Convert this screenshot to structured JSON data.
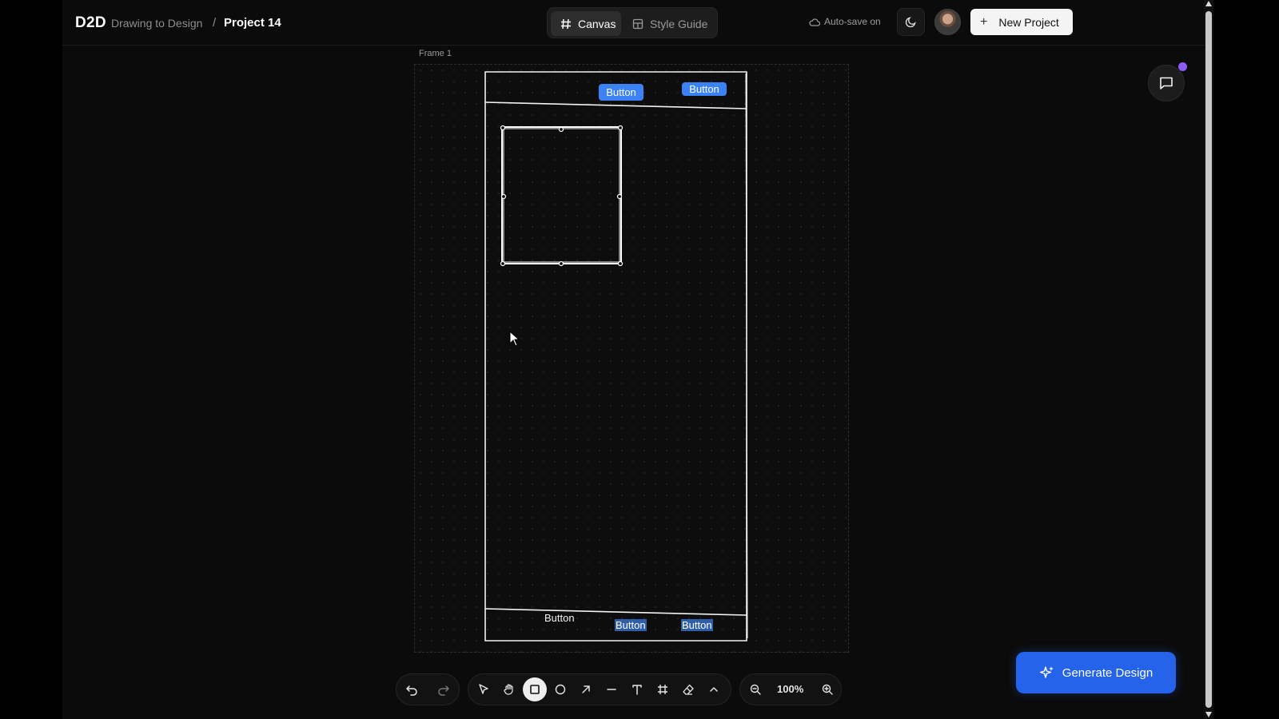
{
  "header": {
    "brand": "D2D",
    "app_name": "Drawing to Design",
    "separator": "/",
    "project_name": "Project 14",
    "tabs": [
      {
        "label": "Canvas",
        "active": true
      },
      {
        "label": "Style Guide",
        "active": false
      }
    ],
    "autosave": "Auto-save on",
    "new_project": "New Project"
  },
  "canvas": {
    "frame_label": "Frame 1",
    "sketch": {
      "top_buttons": [
        "Button",
        "Button"
      ],
      "bottom_buttons": [
        "Button",
        "Button",
        "Button"
      ]
    }
  },
  "toolbar": {
    "tools": [
      "undo",
      "redo",
      "select",
      "hand",
      "rectangle",
      "ellipse",
      "arrow",
      "line",
      "text",
      "frame",
      "eraser",
      "more"
    ],
    "active_tool": "rectangle",
    "zoom": "100%"
  },
  "generate_button": "Generate Design",
  "colors": {
    "accent": "#2563eb",
    "chip": "#3b82f6",
    "notification": "#8b5cf6"
  }
}
